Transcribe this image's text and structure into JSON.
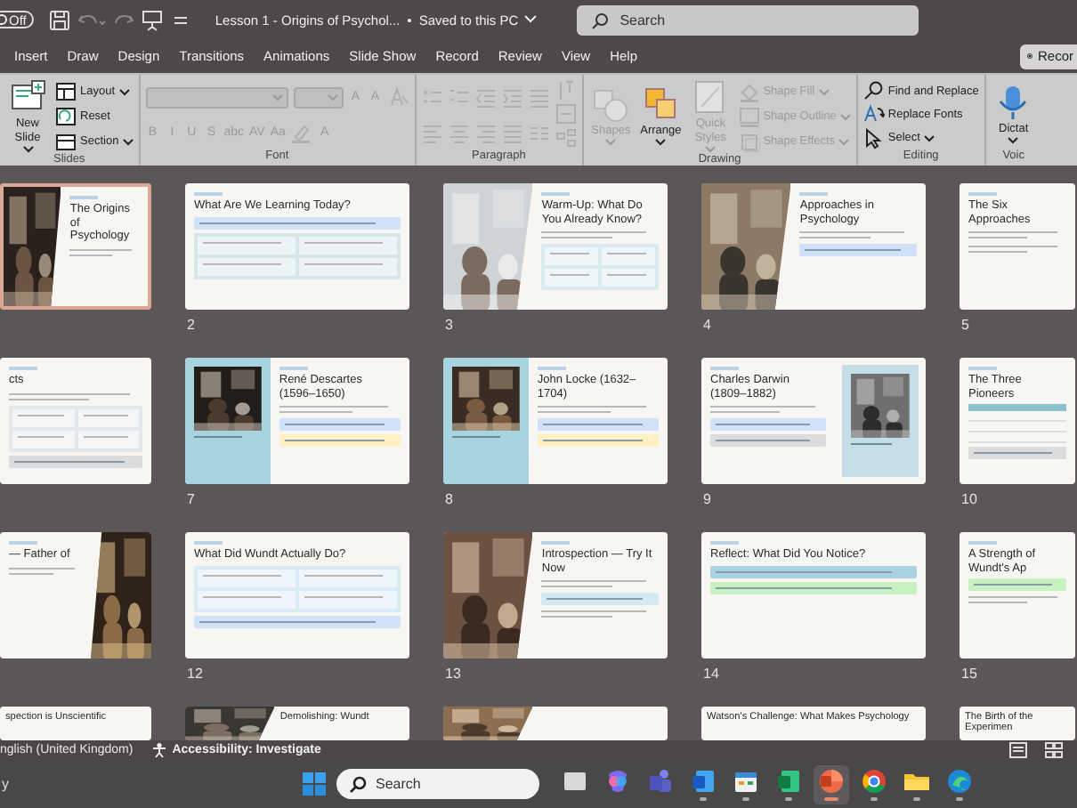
{
  "title_bar": {
    "autosave": {
      "label": "Off",
      "on": false
    },
    "quick_access": [
      {
        "disabled": false
      },
      {
        "disabled": true
      },
      {
        "disabled": true
      },
      {
        "disabled": false
      },
      {
        "disabled": false
      }
    ],
    "document_title": "Lesson 1 - Origins of Psychol...",
    "separator": "•",
    "save_status": "Saved to this PC",
    "search": {
      "placeholder": "Search"
    }
  },
  "tabs": [
    {
      "label": "Insert"
    },
    {
      "label": "Draw"
    },
    {
      "label": "Design"
    },
    {
      "label": "Transitions"
    },
    {
      "label": "Animations"
    },
    {
      "label": "Slide Show"
    },
    {
      "label": "Record"
    },
    {
      "label": "Review"
    },
    {
      "label": "View"
    },
    {
      "label": "Help"
    }
  ],
  "record_button": "Recor",
  "ribbon": [
    {
      "label": "Slides",
      "columns": [
        [
          {
            "kind": "large",
            "label": "New Slide",
            "caret": true,
            "disabled": false
          }
        ],
        [
          {
            "kind": "small",
            "label": "Layout",
            "caret": true,
            "disabled": false
          },
          {
            "kind": "small",
            "label": "Reset",
            "caret": false,
            "disabled": false
          },
          {
            "kind": "small",
            "label": "Section",
            "caret": true,
            "disabled": false
          }
        ]
      ]
    },
    {
      "label": "Font",
      "columns": [
        [
          {
            "kind": "row",
            "items": [
              {
                "kind": "font-box",
                "disabled": true
              },
              {
                "kind": "size-box",
                "disabled": true
              },
              {
                "kind": "glyph",
                "text": "A",
                "disabled": true
              },
              {
                "kind": "glyph",
                "text": "A",
                "disabled": true
              },
              {
                "kind": "icon",
                "disabled": true
              }
            ]
          },
          {
            "kind": "row",
            "items": [
              {
                "kind": "glyph",
                "text": "B",
                "disabled": true
              },
              {
                "kind": "glyph",
                "text": "I",
                "disabled": true
              },
              {
                "kind": "glyph",
                "text": "U",
                "disabled": true
              },
              {
                "kind": "glyph",
                "text": "S",
                "disabled": true
              },
              {
                "kind": "glyph",
                "text": "abc",
                "disabled": true
              },
              {
                "kind": "glyph",
                "text": "AV",
                "disabled": true
              },
              {
                "kind": "glyph",
                "text": "Aa",
                "disabled": true
              },
              {
                "kind": "icon",
                "disabled": true
              },
              {
                "kind": "glyph",
                "text": "A",
                "disabled": true
              }
            ]
          }
        ]
      ]
    },
    {
      "label": "Paragraph",
      "columns": [
        [
          {
            "kind": "row",
            "items": [
              {
                "kind": "icon",
                "disabled": true
              },
              {
                "kind": "icon",
                "disabled": true
              },
              {
                "kind": "icon",
                "disabled": true
              },
              {
                "kind": "icon",
                "disabled": true
              },
              {
                "kind": "icon",
                "disabled": true
              }
            ]
          },
          {
            "kind": "row",
            "items": [
              {
                "kind": "icon",
                "disabled": true
              },
              {
                "kind": "icon",
                "disabled": true
              },
              {
                "kind": "icon",
                "disabled": true
              },
              {
                "kind": "icon",
                "disabled": true
              },
              {
                "kind": "icon",
                "disabled": true
              }
            ]
          }
        ],
        [
          {
            "kind": "icon",
            "disabled": true
          },
          {
            "kind": "icon",
            "disabled": true
          },
          {
            "kind": "icon",
            "disabled": true
          }
        ]
      ]
    },
    {
      "label": "Drawing",
      "columns": [
        [
          {
            "kind": "large",
            "label": "Shapes",
            "caret": true,
            "disabled": true
          }
        ],
        [
          {
            "kind": "large",
            "label": "Arrange",
            "caret": true,
            "disabled": false
          }
        ],
        [
          {
            "kind": "large",
            "label": "Quick Styles",
            "caret": true,
            "disabled": true
          }
        ],
        [
          {
            "kind": "small",
            "label": "Shape Fill",
            "caret": true,
            "disabled": true
          },
          {
            "kind": "small",
            "label": "Shape Outline",
            "caret": true,
            "disabled": true
          },
          {
            "kind": "small",
            "label": "Shape Effects",
            "caret": true,
            "disabled": true
          }
        ]
      ]
    },
    {
      "label": "Editing",
      "columns": [
        [
          {
            "kind": "small",
            "label": "Find and Replace",
            "caret": false,
            "disabled": false
          },
          {
            "kind": "small",
            "label": "Replace Fonts",
            "caret": false,
            "disabled": false
          },
          {
            "kind": "small",
            "label": "Select",
            "caret": true,
            "disabled": false
          }
        ]
      ]
    },
    {
      "label": "Voic",
      "columns": [
        [
          {
            "kind": "large",
            "label": "Dictat",
            "caret": true,
            "disabled": false
          }
        ]
      ]
    }
  ],
  "slides": [
    {
      "title": "The Origins of Psychology",
      "kind": "photo-left",
      "selected": true,
      "blocks": [
        {
          "kind": "lines"
        }
      ]
    },
    {
      "number": "2",
      "title": "What Are We Learning Today?",
      "kind": "text",
      "selected": false,
      "blocks": [
        {
          "kind": "callout",
          "color": "#cfe2f8"
        },
        {
          "kind": "grid",
          "color": "#d6e6ea"
        }
      ]
    },
    {
      "number": "3",
      "title": "Warm-Up: What Do You Already Know?",
      "kind": "photo-left",
      "selected": false,
      "blocks": [
        {
          "kind": "lines"
        },
        {
          "kind": "grid",
          "color": "#d9eaf1"
        }
      ]
    },
    {
      "number": "4",
      "title": "Approaches in Psychology",
      "kind": "photo-left",
      "selected": false,
      "blocks": [
        {
          "kind": "lines"
        },
        {
          "kind": "callout",
          "color": "#cfe0f8"
        }
      ]
    },
    {
      "number": "5",
      "title": "The Six Approaches",
      "kind": "text",
      "selected": false,
      "blocks": [
        {
          "kind": "lines"
        },
        {
          "kind": "lines"
        }
      ]
    },
    {
      "title": "cts",
      "kind": "text",
      "selected": false,
      "blocks": [
        {
          "kind": "lines"
        },
        {
          "kind": "grid",
          "color": "#e4e8ea"
        },
        {
          "kind": "callout",
          "color": "#dcdcdc"
        }
      ]
    },
    {
      "number": "7",
      "title": "René Descartes (1596–1650)",
      "kind": "portrait-left",
      "selected": false,
      "blocks": [
        {
          "kind": "lines"
        },
        {
          "kind": "callout",
          "color": "#cfe2f8"
        },
        {
          "kind": "callout",
          "color": "#fdf1c2"
        }
      ]
    },
    {
      "number": "8",
      "title": "John Locke (1632–1704)",
      "kind": "portrait-left",
      "selected": false,
      "blocks": [
        {
          "kind": "lines"
        },
        {
          "kind": "callout",
          "color": "#cfe2f8"
        },
        {
          "kind": "callout",
          "color": "#fdf1c2"
        }
      ]
    },
    {
      "number": "9",
      "title": "Charles Darwin (1809–1882)",
      "kind": "portrait-right",
      "selected": false,
      "blocks": [
        {
          "kind": "lines"
        },
        {
          "kind": "callout",
          "color": "#cfe2f8"
        },
        {
          "kind": "callout",
          "color": "#dcdcdc"
        }
      ]
    },
    {
      "number": "10",
      "title": "The Three Pioneers",
      "kind": "text",
      "selected": false,
      "blocks": [
        {
          "kind": "table"
        },
        {
          "kind": "callout",
          "color": "#dcdcdc"
        }
      ]
    },
    {
      "title": "— Father of",
      "kind": "photo-right",
      "selected": false,
      "blocks": [
        {
          "kind": "lines"
        }
      ]
    },
    {
      "number": "12",
      "title": "What Did Wundt Actually Do?",
      "kind": "text",
      "selected": false,
      "blocks": [
        {
          "kind": "grid",
          "color": "#d9ecf5"
        },
        {
          "kind": "callout",
          "color": "#cfe2f8"
        }
      ]
    },
    {
      "number": "13",
      "title": "Introspection — Try It Now",
      "kind": "photo-left",
      "selected": false,
      "blocks": [
        {
          "kind": "lines"
        },
        {
          "kind": "callout",
          "color": "#d4e9f2"
        },
        {
          "kind": "lines"
        }
      ]
    },
    {
      "number": "14",
      "title": "Reflect: What Did You Notice?",
      "kind": "text",
      "selected": false,
      "blocks": [
        {
          "kind": "callout",
          "color": "#a9d3e3"
        },
        {
          "kind": "callout",
          "color": "#c9f0c0"
        }
      ]
    },
    {
      "number": "15",
      "title": "A Strength of Wundt's Ap",
      "kind": "text",
      "selected": false,
      "blocks": [
        {
          "kind": "callout",
          "color": "#c9f0c0"
        },
        {
          "kind": "lines"
        }
      ]
    },
    {
      "title": "spection is Unscientific",
      "kind": "text",
      "selected": false
    },
    {
      "title": "Demolishing: Wundt",
      "kind": "photo-left",
      "selected": false
    },
    {
      "kind": "photo-left",
      "selected": false
    },
    {
      "title": "Watson's Challenge: What Makes Psychology",
      "kind": "text",
      "selected": false
    },
    {
      "title": "The Birth of the Experimen",
      "kind": "text",
      "selected": false
    }
  ],
  "status_bar": {
    "language": "nglish (United Kingdom)",
    "accessibility": "Accessibility: Investigate"
  },
  "taskbar": {
    "widget_text": "y",
    "search": {
      "placeholder": "Search"
    },
    "apps": [
      {
        "running": false,
        "selected": false
      },
      {
        "running": false,
        "selected": false
      },
      {
        "running": false,
        "selected": false
      },
      {
        "running": true,
        "selected": false
      },
      {
        "running": true,
        "selected": false
      },
      {
        "running": true,
        "selected": false
      },
      {
        "running": true,
        "selected": true
      },
      {
        "running": true,
        "selected": false
      },
      {
        "running": true,
        "selected": false
      },
      {
        "running": true,
        "selected": false
      }
    ]
  }
}
